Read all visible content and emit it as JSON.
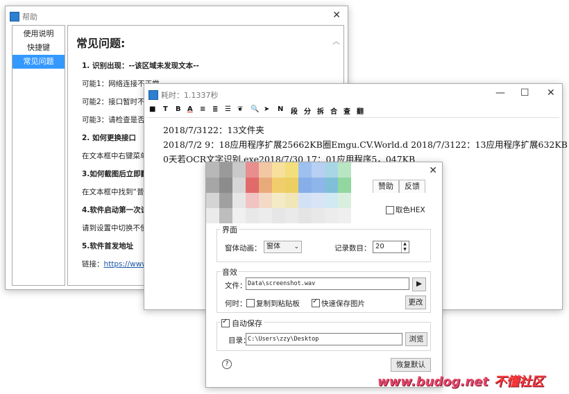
{
  "help_window": {
    "title": "帮助",
    "nav": [
      "使用说明",
      "快捷键",
      "常见问题"
    ],
    "heading": "常见问题:",
    "lines": [
      "1. 识别出现：--该区域未发现文本--",
      "可能1：网络连接不正常",
      "可能2：接口暂时不",
      "可能3：请检查是否",
      "2. 如何更换接口",
      "在文本框中右键菜单",
      "3.如何截图后立即翻",
      "在文本框中找到“普",
      "4.软件启动第一次试",
      "请到设置中切换不使",
      "5.软件首发地址",
      "链接："
    ],
    "link": "https://www"
  },
  "timing_window": {
    "title": "耗时：1.1337秒",
    "toolbar": [
      "■",
      "T",
      "B",
      "A",
      "≡",
      "≣",
      "☰",
      "❦",
      "🔍",
      "➤",
      "N",
      "段",
      "分",
      "拆",
      "合",
      "查",
      "翻"
    ],
    "lines": [
      "2018/7/3122：13文件夹",
      "2018/7/2 9：18应用程序扩展25662KB圈Emgu.CV.World.d 2018/7/3122：13应用程序扩展632KB",
      "0天若OCR文字识别.exe2018/7/30 17：01应用程序5，047KB"
    ]
  },
  "settings_window": {
    "tabs": [
      "赞助",
      "反馈"
    ],
    "color_hex": "取色HEX",
    "interface": {
      "label": "界面",
      "anim_label": "窗体动画：",
      "anim_value": "窗体",
      "records_label": "记录数目：",
      "records_value": "20"
    },
    "sound": {
      "label": "音效",
      "file_label": "文件：",
      "file_value": "Data\\screenshot.wav",
      "when_label": "何时：",
      "copy_clip": "复制到粘贴板",
      "fast_save": "快速保存图片",
      "change": "更改"
    },
    "autosave": {
      "label": "自动保存",
      "dir_label": "目录：",
      "dir_value": "C:\\Users\\zzy\\Desktop",
      "browse": "浏览"
    },
    "restore": "恢复默认",
    "help": "?"
  },
  "watermark": {
    "url": "www.budog.net",
    "cn": "不懂社区"
  },
  "colors": {
    "selection": "#3399ff",
    "link": "#1a55a8",
    "watermark": "#e8476b"
  }
}
